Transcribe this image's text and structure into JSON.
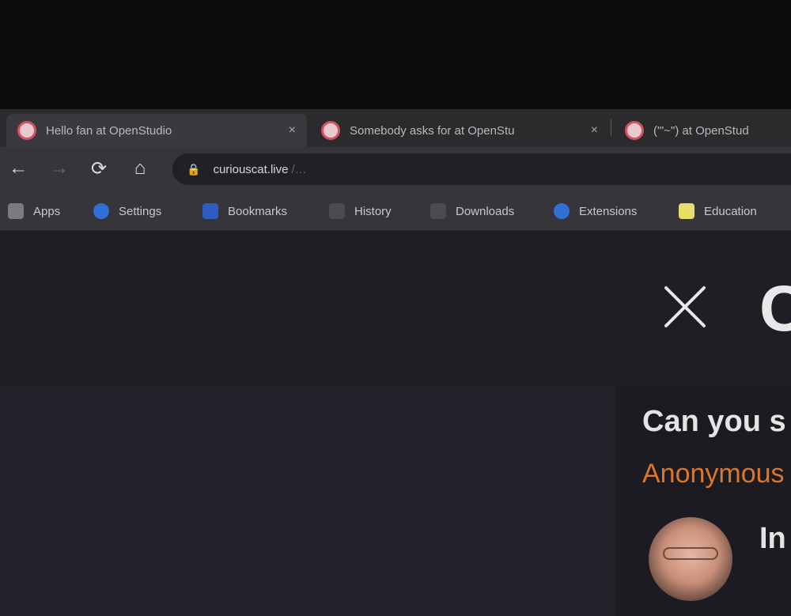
{
  "browser": {
    "tabs": [
      {
        "title": "Hello fan at OpenStudio",
        "close": "×",
        "active": true
      },
      {
        "title": "Somebody asks for at OpenStu",
        "close": "×",
        "active": false
      },
      {
        "title": "(\"'~\") at OpenStud",
        "close": "",
        "active": false
      }
    ],
    "nav": {
      "back": "←",
      "forward": "→",
      "reload": "⟳",
      "home": "⌂"
    },
    "omnibox": {
      "lock": "🔒",
      "url": "curiouscat.live",
      "url_tail": "/…"
    },
    "bookmarks": [
      {
        "label": "Apps",
        "icon": "apps-grid-icon",
        "color": "#7a7a80"
      },
      {
        "label": "Settings",
        "icon": "settings-icon",
        "color": "#2f6fd6"
      },
      {
        "label": "Bookmarks",
        "icon": "bookmarks-icon",
        "color": "#2f5cc0"
      },
      {
        "label": "History",
        "icon": "history-icon",
        "color": "#4a4a52"
      },
      {
        "label": "Downloads",
        "icon": "downloads-icon",
        "color": "#4a4a52"
      },
      {
        "label": "Extensions",
        "icon": "extensions-icon",
        "color": "#2f6fd6"
      },
      {
        "label": "Education",
        "icon": "folder-icon",
        "color": "#e8df68"
      }
    ]
  },
  "page": {
    "close_icon": "close-icon",
    "header_letter": "C",
    "question": "Can you s",
    "asker": "Anonymous",
    "answerer": "In"
  },
  "colors": {
    "accent_orange": "#d9782a",
    "tab_favicon": "#d6505e"
  }
}
